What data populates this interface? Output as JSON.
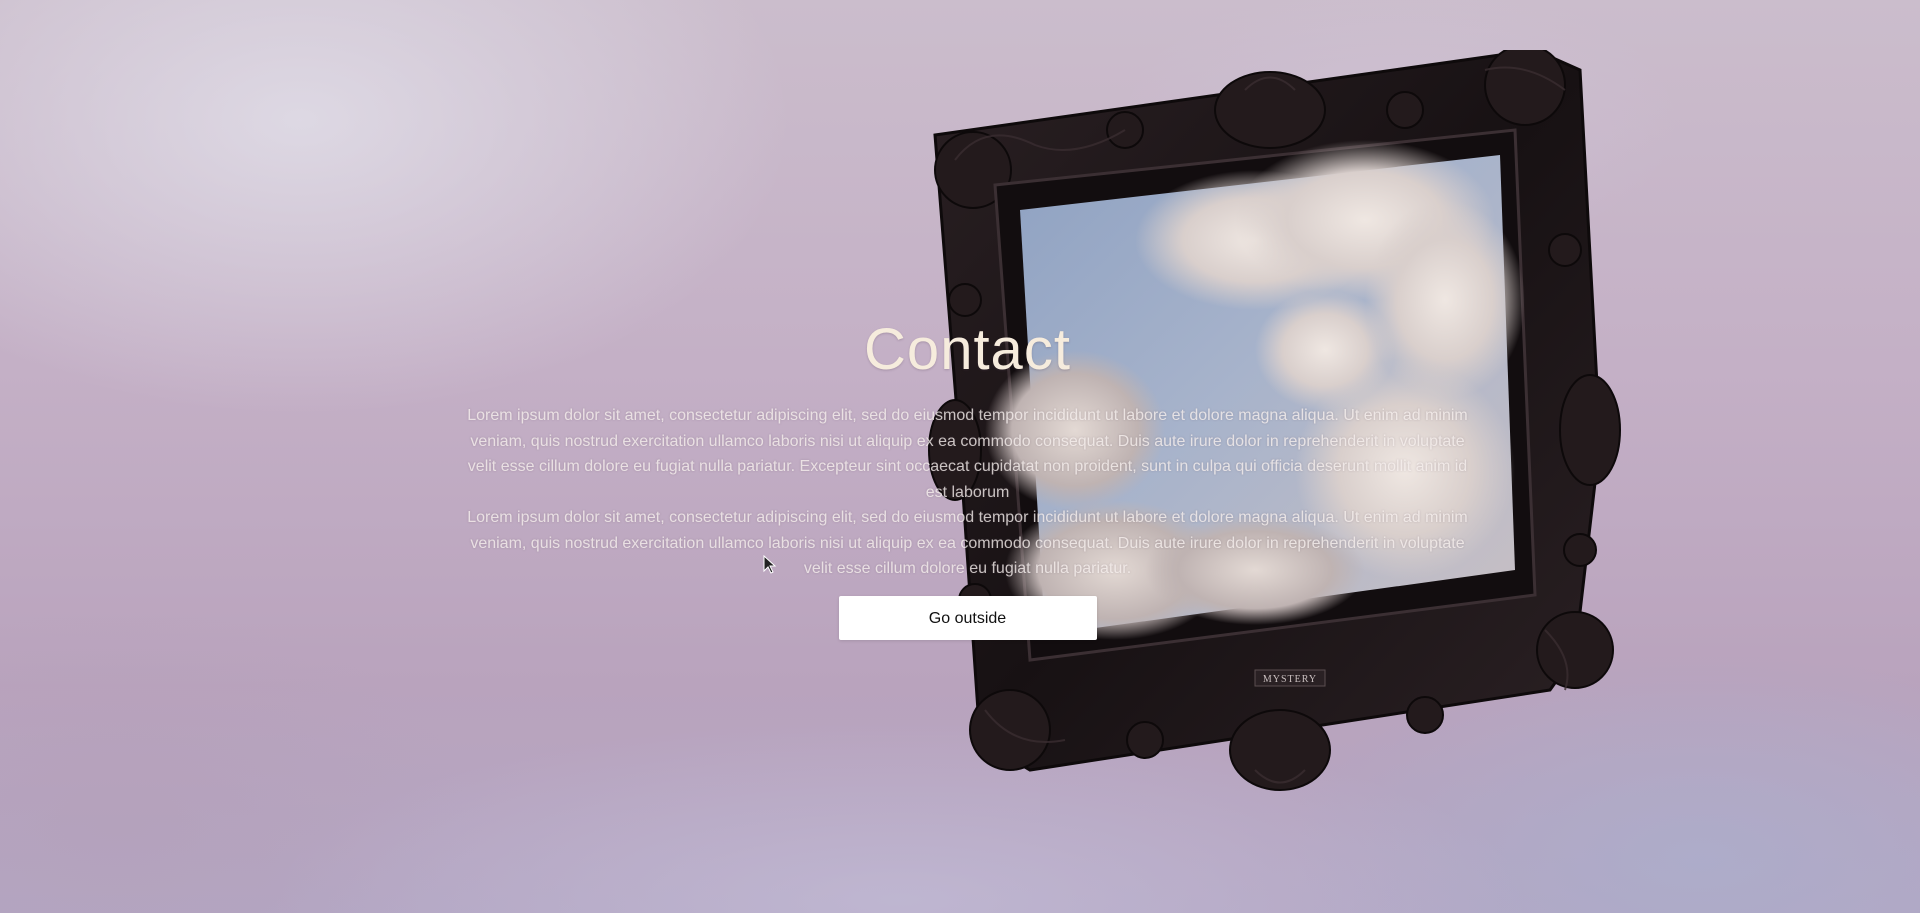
{
  "page": {
    "title": "Contact",
    "paragraphs": [
      "Lorem ipsum dolor sit amet, consectetur adipiscing elit, sed do eiusmod tempor incididunt ut labore et dolore magna aliqua. Ut enim ad minim veniam, quis nostrud exercitation ullamco laboris nisi ut aliquip ex ea commodo consequat. Duis aute irure dolor in reprehenderit in voluptate velit esse cillum dolore eu fugiat nulla pariatur. Excepteur sint occaecat cupidatat non proident, sunt in culpa qui officia deserunt mollit anim id est laborum",
      "Lorem ipsum dolor sit amet, consectetur adipiscing elit, sed do eiusmod tempor incididunt ut labore et dolore magna aliqua. Ut enim ad minim veniam, quis nostrud exercitation ullamco laboris nisi ut aliquip ex ea commodo consequat. Duis aute irure dolor in reprehenderit in voluptate velit esse cillum dolore eu fugiat nulla pariatur."
    ],
    "button_label": "Go outside"
  },
  "frame": {
    "plaque_text": "MYSTERY"
  },
  "colors": {
    "title": "#f6ecdd",
    "frame": "#1c1416",
    "button_bg": "#ffffff"
  }
}
